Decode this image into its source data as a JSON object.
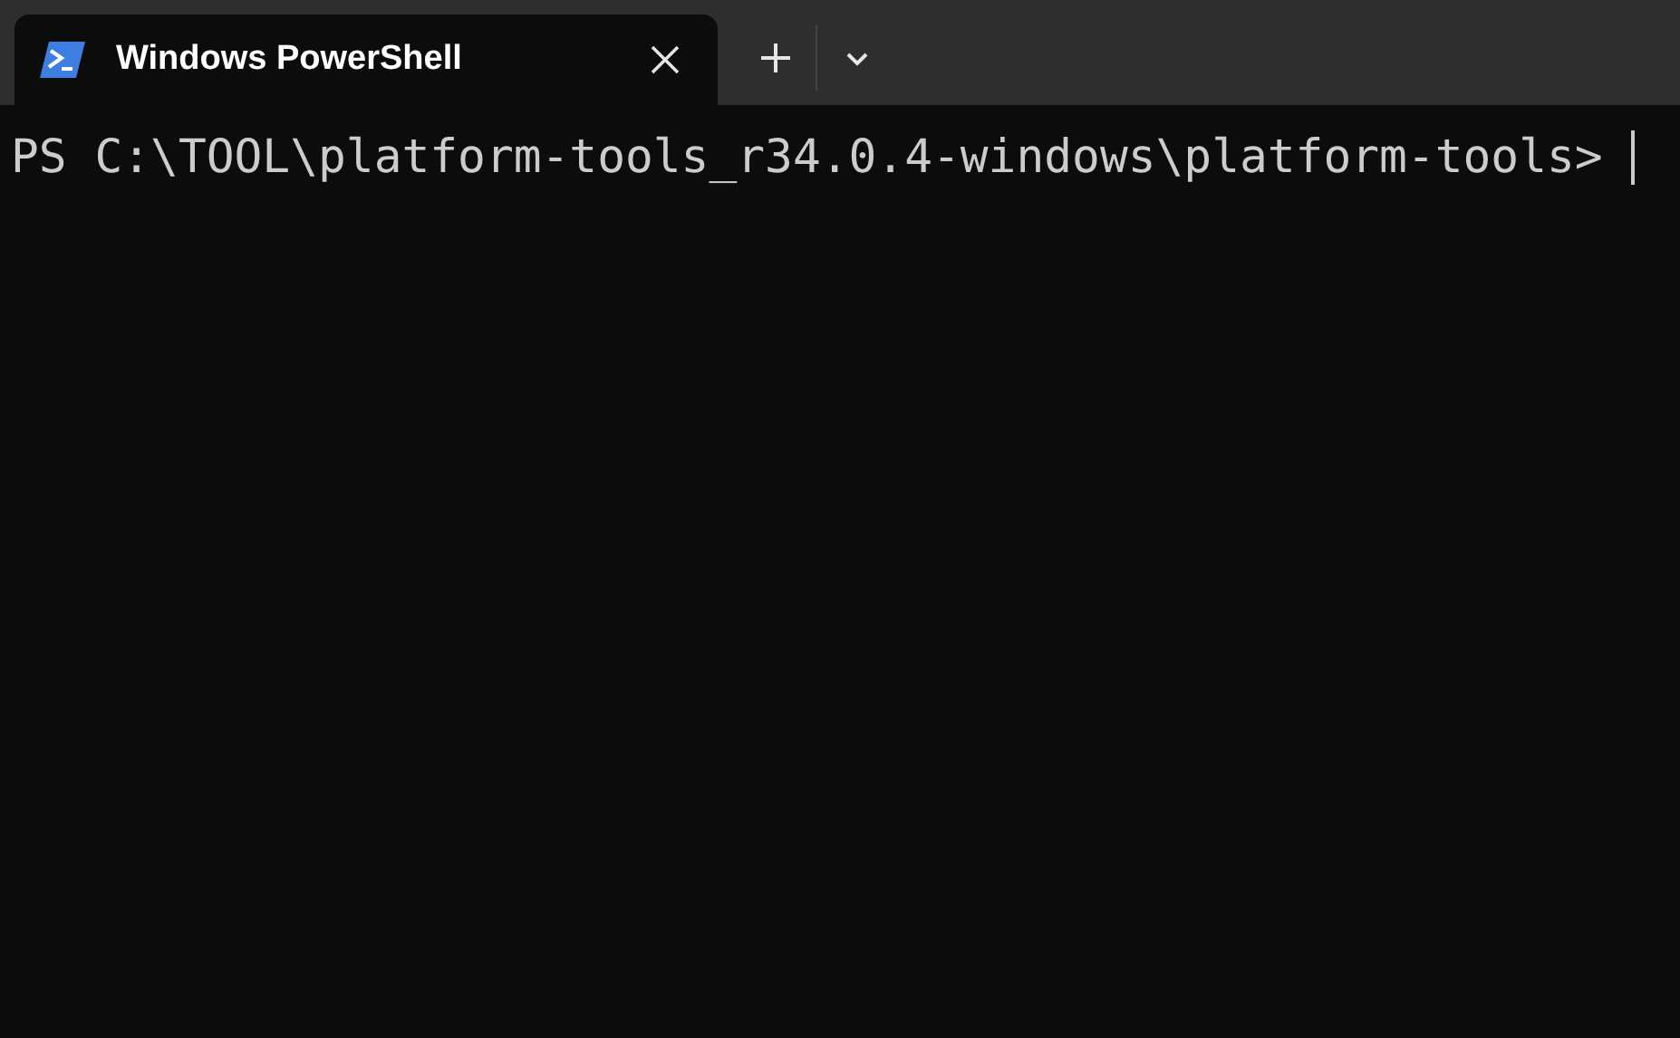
{
  "tabs": [
    {
      "title": "Windows PowerShell",
      "selected": true
    }
  ],
  "terminal": {
    "lines": [
      "PS C:\\TOOL\\platform-tools_r34.0.4-windows\\platform-tools>"
    ],
    "cursor_visible": true
  }
}
